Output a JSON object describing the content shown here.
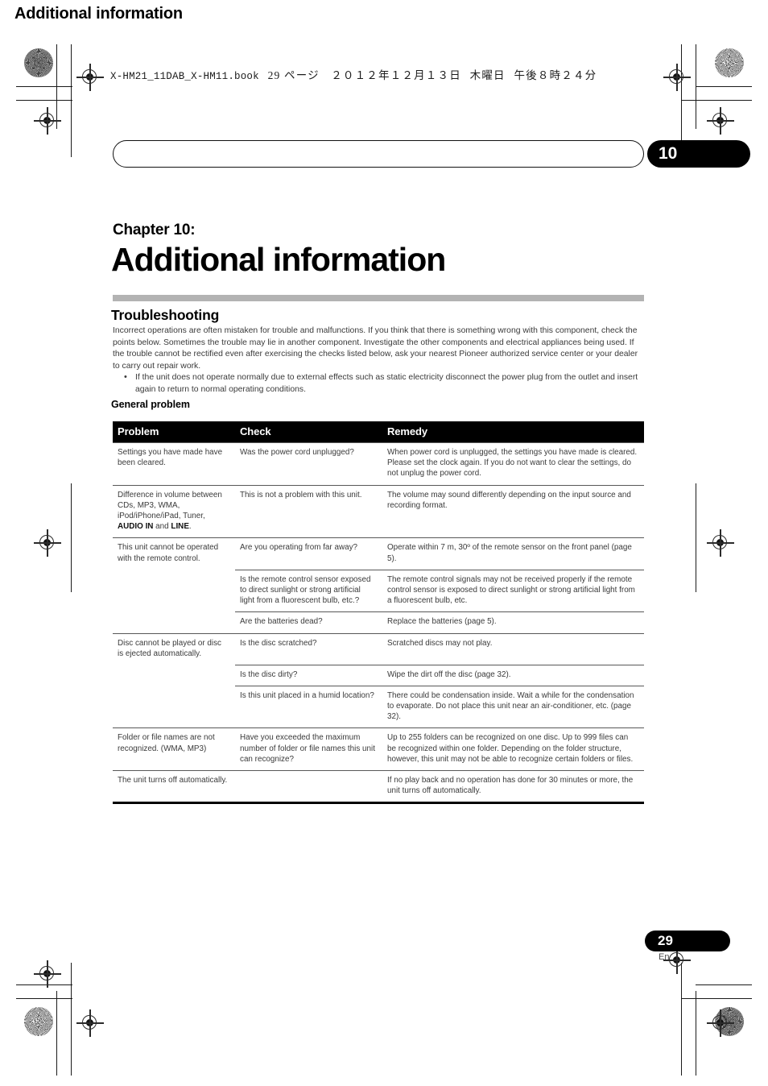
{
  "file_banner": {
    "filename": "X-HM21_11DAB_X-HM11.book",
    "page_label": "29 ページ",
    "date": "２０１２年１２月１３日",
    "weekday": "木曜日",
    "time": "午後８時２４分"
  },
  "running_head": {
    "title": "Additional information",
    "chapter_number": "10"
  },
  "chapter": {
    "label": "Chapter 10:",
    "title": "Additional information"
  },
  "section": {
    "title": "Troubleshooting",
    "intro": "Incorrect operations are often mistaken for trouble and malfunctions. If you think that there is something wrong with this component, check the points below. Sometimes the trouble may lie in another component. Investigate the other components and electrical appliances being used. If the trouble cannot be rectified even after exercising the checks listed below, ask your nearest Pioneer authorized service center or your dealer to carry out repair work.",
    "bullets": [
      "If the unit does not operate normally due to external effects such as static electricity disconnect the power plug from the outlet and insert again to return to normal operating conditions."
    ],
    "subsection_title": "General problem"
  },
  "table": {
    "headers": {
      "problem": "Problem",
      "check": "Check",
      "remedy": "Remedy"
    },
    "rows": [
      {
        "group": true,
        "problem": "Settings you have made have been cleared.",
        "check": "Was the power cord unplugged?",
        "remedy": "When power cord is unplugged, the settings you have made is cleared. Please set the clock again. If you do not want to clear the settings, do not unplug the power cord."
      },
      {
        "group": true,
        "problem_parts": [
          {
            "text": "Difference in volume between CDs, MP3, WMA, iPod/iPhone/iPad, Tuner, ",
            "bold": false
          },
          {
            "text": "AUDIO IN",
            "bold": true
          },
          {
            "text": " and ",
            "bold": false
          },
          {
            "text": "LINE",
            "bold": true
          },
          {
            "text": ".",
            "bold": false
          }
        ],
        "problem": "Difference in volume between CDs, MP3, WMA, iPod/iPhone/iPad, Tuner, AUDIO IN and LINE.",
        "check": "This is not a problem with this unit.",
        "remedy": "The volume may sound differently depending on the input source and recording format."
      },
      {
        "group": true,
        "problem": "This unit cannot be operated with the remote control.",
        "check": "Are you operating from far away?",
        "remedy": "Operate within 7 m, 30º of the remote sensor on the front panel (page 5)."
      },
      {
        "group": false,
        "problem": "",
        "check": "Is the remote control sensor exposed to direct sunlight or strong artificial light from a fluorescent bulb, etc.?",
        "remedy": "The remote control signals may not be received properly if the remote control sensor is exposed to direct sunlight or strong artificial light from a fluorescent bulb, etc."
      },
      {
        "group": false,
        "problem": "",
        "check": "Are the batteries dead?",
        "remedy": "Replace the batteries (page 5)."
      },
      {
        "group": true,
        "problem": "Disc cannot be played or disc is ejected automatically.",
        "check": "Is the disc scratched?",
        "remedy": "Scratched discs may not play."
      },
      {
        "group": false,
        "problem": "",
        "check": "Is the disc dirty?",
        "remedy": "Wipe the dirt off the disc (page 32)."
      },
      {
        "group": false,
        "problem": "",
        "check": "Is this unit placed in a humid location?",
        "remedy": "There could be condensation inside. Wait a while for the condensation to evaporate. Do not place this unit near an air-conditioner, etc. (page 32)."
      },
      {
        "group": true,
        "problem": "Folder or file names are not recognized. (WMA, MP3)",
        "check": "Have you exceeded the maximum number of folder or file names this unit can recognize?",
        "remedy": "Up to 255 folders can be recognized on one disc. Up to 999 files can be recognized within one folder. Depending on the folder structure, however, this unit may not be able to recognize certain folders or files."
      },
      {
        "group": true,
        "last": true,
        "problem": "The unit turns off automatically.",
        "check": "",
        "remedy": "If no play back and no operation has done for 30 minutes or more, the unit turns off automatically."
      }
    ]
  },
  "footer": {
    "page_number": "29",
    "language": "En"
  },
  "colors": {
    "accent_black": "#000000",
    "gray_rule": "#b3b3b3",
    "body_text": "#3a3a3a"
  }
}
